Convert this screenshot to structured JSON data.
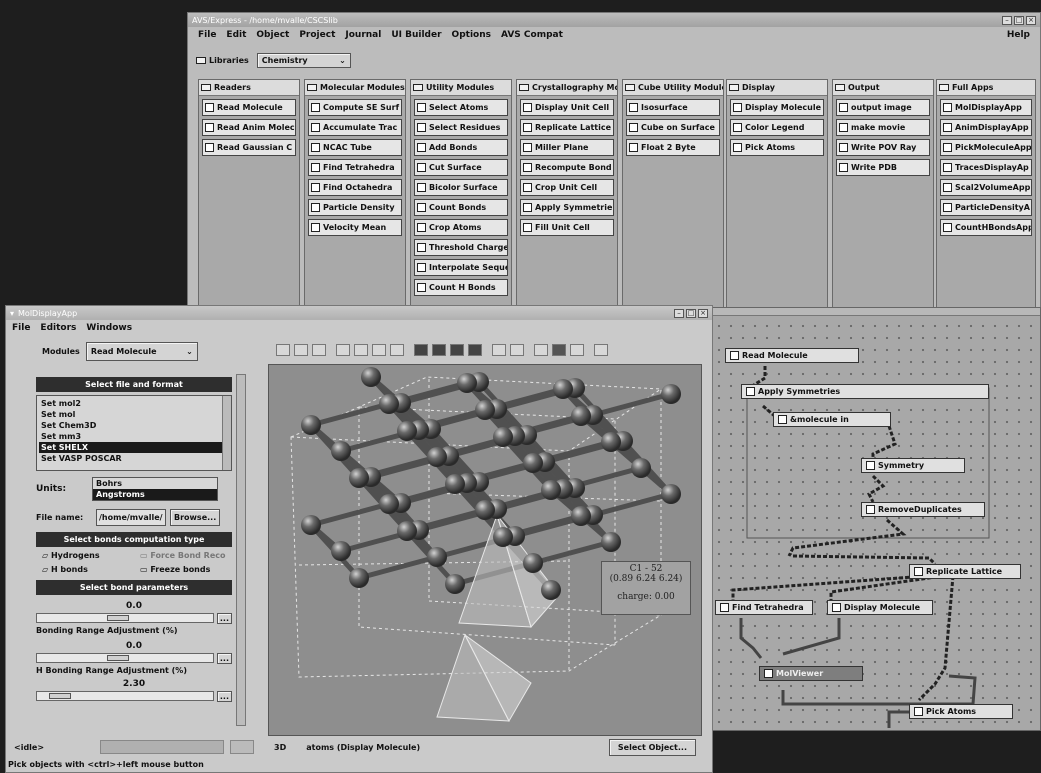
{
  "avs": {
    "title": "AVS/Express - /home/mvalle/CSCSlib",
    "menu": [
      "File",
      "Edit",
      "Object",
      "Project",
      "Journal",
      "UI Builder",
      "Options",
      "AVS Compat"
    ],
    "help": "Help",
    "libraries_label": "Libraries",
    "library_selected": "Chemistry",
    "palettes": [
      {
        "title": "Readers",
        "items": [
          "Read Molecule",
          "Read Anim Molec",
          "Read Gaussian C"
        ]
      },
      {
        "title": "Molecular Modules",
        "items": [
          "Compute SE Surf",
          "Accumulate Trac",
          "NCAC Tube",
          "Find Tetrahedra",
          "Find Octahedra",
          "Particle Density",
          "Velocity Mean"
        ]
      },
      {
        "title": "Utility Modules",
        "items": [
          "Select Atoms",
          "Select Residues",
          "Add Bonds",
          "Cut Surface",
          "Bicolor Surface",
          "Count Bonds",
          "Crop Atoms",
          "Threshold Charge",
          "Interpolate Seque",
          "Count H Bonds"
        ]
      },
      {
        "title": "Crystallography Mo",
        "items": [
          "Display Unit Cell",
          "Replicate Lattice",
          "Miller Plane",
          "Recompute Bond",
          "Crop Unit Cell",
          "Apply Symmetrie",
          "Fill Unit Cell"
        ]
      },
      {
        "title": "Cube Utility Module",
        "items": [
          "Isosurface",
          "Cube on Surface",
          "Float 2 Byte"
        ]
      },
      {
        "title": "Display",
        "items": [
          "Display Molecule",
          "Color Legend",
          "Pick Atoms"
        ]
      },
      {
        "title": "Output",
        "items": [
          "output image",
          "make movie",
          "Write POV Ray",
          "Write PDB"
        ]
      },
      {
        "title": "Full Apps",
        "items": [
          "MolDisplayApp",
          "AnimDisplayApp",
          "PickMoleculeApp",
          "TracesDisplayAp",
          "Scal2VolumeApp",
          "ParticleDensityA",
          "CountHBondsApp"
        ]
      }
    ]
  },
  "network": {
    "nodes": [
      "Read Molecule",
      "Apply Symmetries",
      "&molecule in",
      "Symmetry",
      "RemoveDuplicates",
      "Replicate Lattice",
      "Find Tetrahedra",
      "Display Molecule",
      "MolViewer",
      "Pick Atoms"
    ]
  },
  "app": {
    "title": "MolDisplayApp",
    "menu": [
      "File",
      "Editors",
      "Windows"
    ],
    "modules_label": "Modules",
    "module_selected": "Read Molecule",
    "section_file": "Select file and format",
    "formats": [
      "Set mol2",
      "Set mol",
      "Set Chem3D",
      "Set mm3",
      "Set SHELX",
      "Set VASP POSCAR"
    ],
    "units_label": "Units:",
    "units": [
      "Bohrs",
      "Angstroms"
    ],
    "file_label": "File name:",
    "file_value": "/home/mvalle/",
    "browse": "Browse...",
    "section_bonds": "Select bonds computation type",
    "hydrogens": "Hydrogens",
    "force_bond": "Force Bond Reco",
    "h_bonds": "H bonds",
    "freeze_bonds": "Freeze bonds",
    "section_params": "Select bond parameters",
    "bonding_value": "0.0",
    "bonding_label": "Bonding Range Adjustment (%)",
    "hbond_value": "0.0",
    "hbond_label": "H Bonding Range Adjustment (%)",
    "third_value": "2.30",
    "more": "...",
    "tip_atom": "C1 - 52",
    "tip_coords": "(0.89 6.24 6.24)",
    "tip_charge": "charge: 0.00",
    "status": "idle",
    "mode": "3D",
    "object_label": "atoms (Display Molecule)",
    "select_object": "Select Object...",
    "hint": "Pick objects with <ctrl>+left mouse button"
  }
}
